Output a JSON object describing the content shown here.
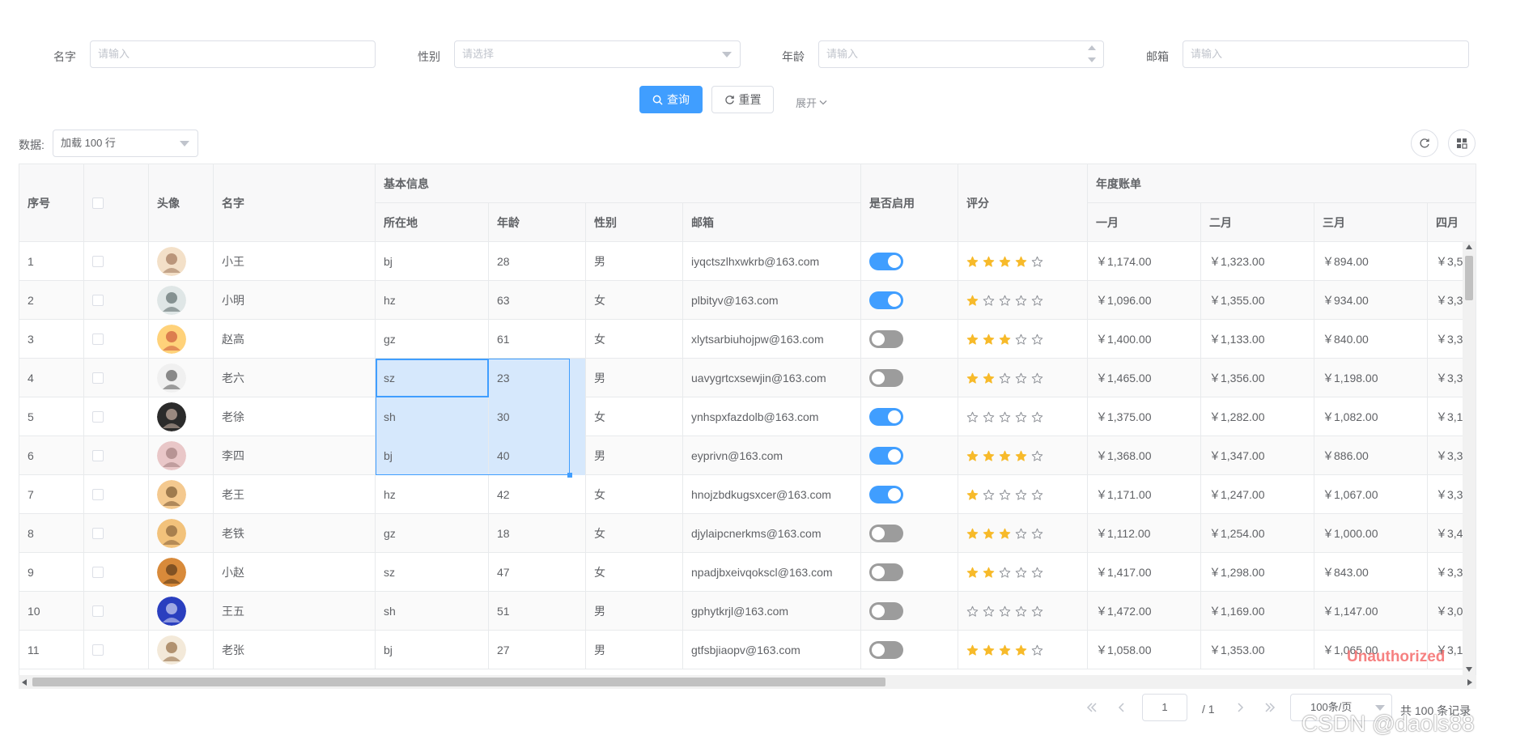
{
  "form": {
    "name_label": "名字",
    "name_placeholder": "请输入",
    "gender_label": "性别",
    "gender_placeholder": "请选择",
    "age_label": "年龄",
    "age_placeholder": "请输入",
    "email_label": "邮箱",
    "email_placeholder": "请输入",
    "query_label": "查询",
    "reset_label": "重置",
    "expand_label": "展开"
  },
  "toolbar": {
    "data_label": "数据:",
    "data_select_value": "加载 100 行"
  },
  "table": {
    "headers": {
      "seq": "序号",
      "avatar": "头像",
      "name": "名字",
      "basic_info": "基本信息",
      "location": "所在地",
      "age": "年龄",
      "gender": "性别",
      "email": "邮箱",
      "enabled": "是否启用",
      "rating": "评分",
      "annual_bill": "年度账单",
      "jan": "一月",
      "feb": "二月",
      "mar": "三月",
      "apr": "四月"
    },
    "rows": [
      {
        "seq": "1",
        "name": "小王",
        "loc": "bj",
        "age": "28",
        "gender": "男",
        "email": "iyqctszlhxwkrb@163.com",
        "enabled": true,
        "rate": 4,
        "jan": "￥1,174.00",
        "feb": "￥1,323.00",
        "mar": "￥894.00",
        "apr": "￥3,5"
      },
      {
        "seq": "2",
        "name": "小明",
        "loc": "hz",
        "age": "63",
        "gender": "女",
        "email": "plbityv@163.com",
        "enabled": true,
        "rate": 1,
        "jan": "￥1,096.00",
        "feb": "￥1,355.00",
        "mar": "￥934.00",
        "apr": "￥3,3"
      },
      {
        "seq": "3",
        "name": "赵高",
        "loc": "gz",
        "age": "61",
        "gender": "女",
        "email": "xlytsarbiuhojpw@163.com",
        "enabled": false,
        "rate": 3,
        "jan": "￥1,400.00",
        "feb": "￥1,133.00",
        "mar": "￥840.00",
        "apr": "￥3,3"
      },
      {
        "seq": "4",
        "name": "老六",
        "loc": "sz",
        "age": "23",
        "gender": "男",
        "email": "uavygrtcxsewjin@163.com",
        "enabled": false,
        "rate": 2,
        "jan": "￥1,465.00",
        "feb": "￥1,356.00",
        "mar": "￥1,198.00",
        "apr": "￥3,3"
      },
      {
        "seq": "5",
        "name": "老徐",
        "loc": "sh",
        "age": "30",
        "gender": "女",
        "email": "ynhspxfazdolb@163.com",
        "enabled": true,
        "rate": 0,
        "jan": "￥1,375.00",
        "feb": "￥1,282.00",
        "mar": "￥1,082.00",
        "apr": "￥3,1"
      },
      {
        "seq": "6",
        "name": "李四",
        "loc": "bj",
        "age": "40",
        "gender": "男",
        "email": "eyprivn@163.com",
        "enabled": true,
        "rate": 4,
        "jan": "￥1,368.00",
        "feb": "￥1,347.00",
        "mar": "￥886.00",
        "apr": "￥3,3"
      },
      {
        "seq": "7",
        "name": "老王",
        "loc": "hz",
        "age": "42",
        "gender": "女",
        "email": "hnojzbdkugsxcer@163.com",
        "enabled": true,
        "rate": 1,
        "jan": "￥1,171.00",
        "feb": "￥1,247.00",
        "mar": "￥1,067.00",
        "apr": "￥3,3"
      },
      {
        "seq": "8",
        "name": "老铁",
        "loc": "gz",
        "age": "18",
        "gender": "女",
        "email": "djylaipcnerkms@163.com",
        "enabled": false,
        "rate": 3,
        "jan": "￥1,112.00",
        "feb": "￥1,254.00",
        "mar": "￥1,000.00",
        "apr": "￥3,4"
      },
      {
        "seq": "9",
        "name": "小赵",
        "loc": "sz",
        "age": "47",
        "gender": "女",
        "email": "npadjbxeivqokscl@163.com",
        "enabled": false,
        "rate": 2,
        "jan": "￥1,417.00",
        "feb": "￥1,298.00",
        "mar": "￥843.00",
        "apr": "￥3,3"
      },
      {
        "seq": "10",
        "name": "王五",
        "loc": "sh",
        "age": "51",
        "gender": "男",
        "email": "gphytkrjl@163.com",
        "enabled": false,
        "rate": 0,
        "jan": "￥1,472.00",
        "feb": "￥1,169.00",
        "mar": "￥1,147.00",
        "apr": "￥3,0"
      },
      {
        "seq": "11",
        "name": "老张",
        "loc": "bj",
        "age": "27",
        "gender": "男",
        "email": "gtfsbjiaopv@163.com",
        "enabled": false,
        "rate": 4,
        "jan": "￥1,058.00",
        "feb": "￥1,353.00",
        "mar": "￥1,065.00",
        "apr": "￥3,1"
      }
    ]
  },
  "pager": {
    "current_page": "1",
    "total_pages": "/ 1",
    "page_size": "100条/页",
    "total_text": "共 100 条记录"
  },
  "overlay": {
    "unauthorized": "Unauthorized",
    "watermark": "CSDN @daols88"
  },
  "colors": {
    "primary": "#409eff",
    "star_on": "#f7ba2a",
    "selection": "#d6e8fc",
    "unauthorized": "#f56c6c"
  }
}
